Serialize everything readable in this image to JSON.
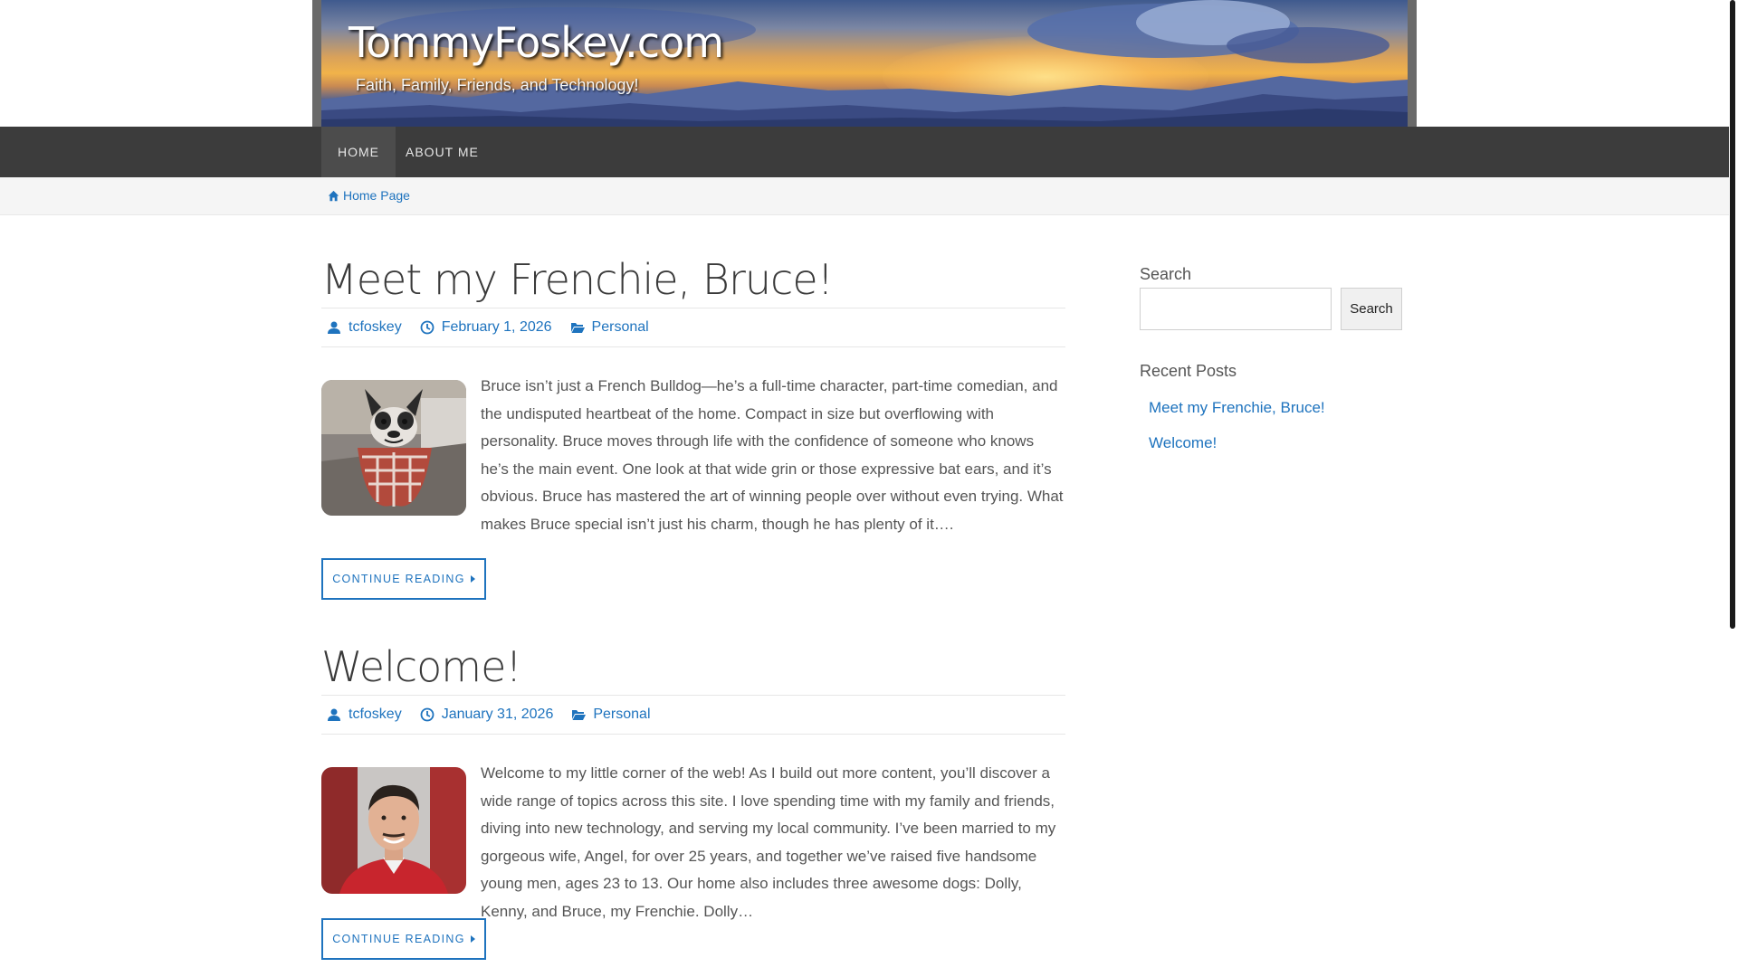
{
  "site": {
    "title": "TommyFoskey.com",
    "tagline": "Faith, Family, Friends, and Technology!"
  },
  "nav": {
    "items": [
      {
        "label": "HOME",
        "active": true
      },
      {
        "label": "ABOUT ME",
        "active": false
      }
    ]
  },
  "breadcrumb": {
    "icon": "home-icon",
    "label": "Home Page"
  },
  "posts": [
    {
      "title": "Meet my Frenchie, Bruce!",
      "author": "tcfoskey",
      "date": "February 1, 2026",
      "category": "Personal",
      "thumbnail": "french-bulldog-photo",
      "excerpt": "Bruce isn’t just a French Bulldog—he’s a full-time character, part-time comedian, and the undisputed heartbeat of the home. Compact in size but overflowing with personality. Bruce moves through life with the confidence of someone who knows he’s the main event. One look at that wide grin or those expressive bat ears, and it’s obvious. Bruce has mastered the art of winning people over without even trying. What makes Bruce special isn’t just his charm, though he has plenty of it….",
      "button": "CONTINUE READING"
    },
    {
      "title": "Welcome!",
      "author": "tcfoskey",
      "date": "January 31, 2026",
      "category": "Personal",
      "thumbnail": "author-portrait-photo",
      "excerpt": "Welcome to my little corner of the web! As I build out more content, you’ll discover a wide range of topics across this site. I love spending time with my family and friends, diving into new technology, and serving my local community. I’ve been married to my gorgeous wife, Angel, for over 25 years, and together we’ve raised five handsome young men, ages 23 to 13. Our home also includes three awesome dogs: Dolly, Kenny, and Bruce, my Frenchie. Dolly…",
      "button": "CONTINUE READING"
    }
  ],
  "sidebar": {
    "search_label": "Search",
    "search_button": "Search",
    "search_value": "",
    "recent_title": "Recent Posts",
    "recent": [
      "Meet my Frenchie, Bruce!",
      "Welcome!"
    ]
  },
  "colors": {
    "link": "#1e73be",
    "nav_bg": "#3c3c3c",
    "nav_active": "#4c4c4c"
  }
}
